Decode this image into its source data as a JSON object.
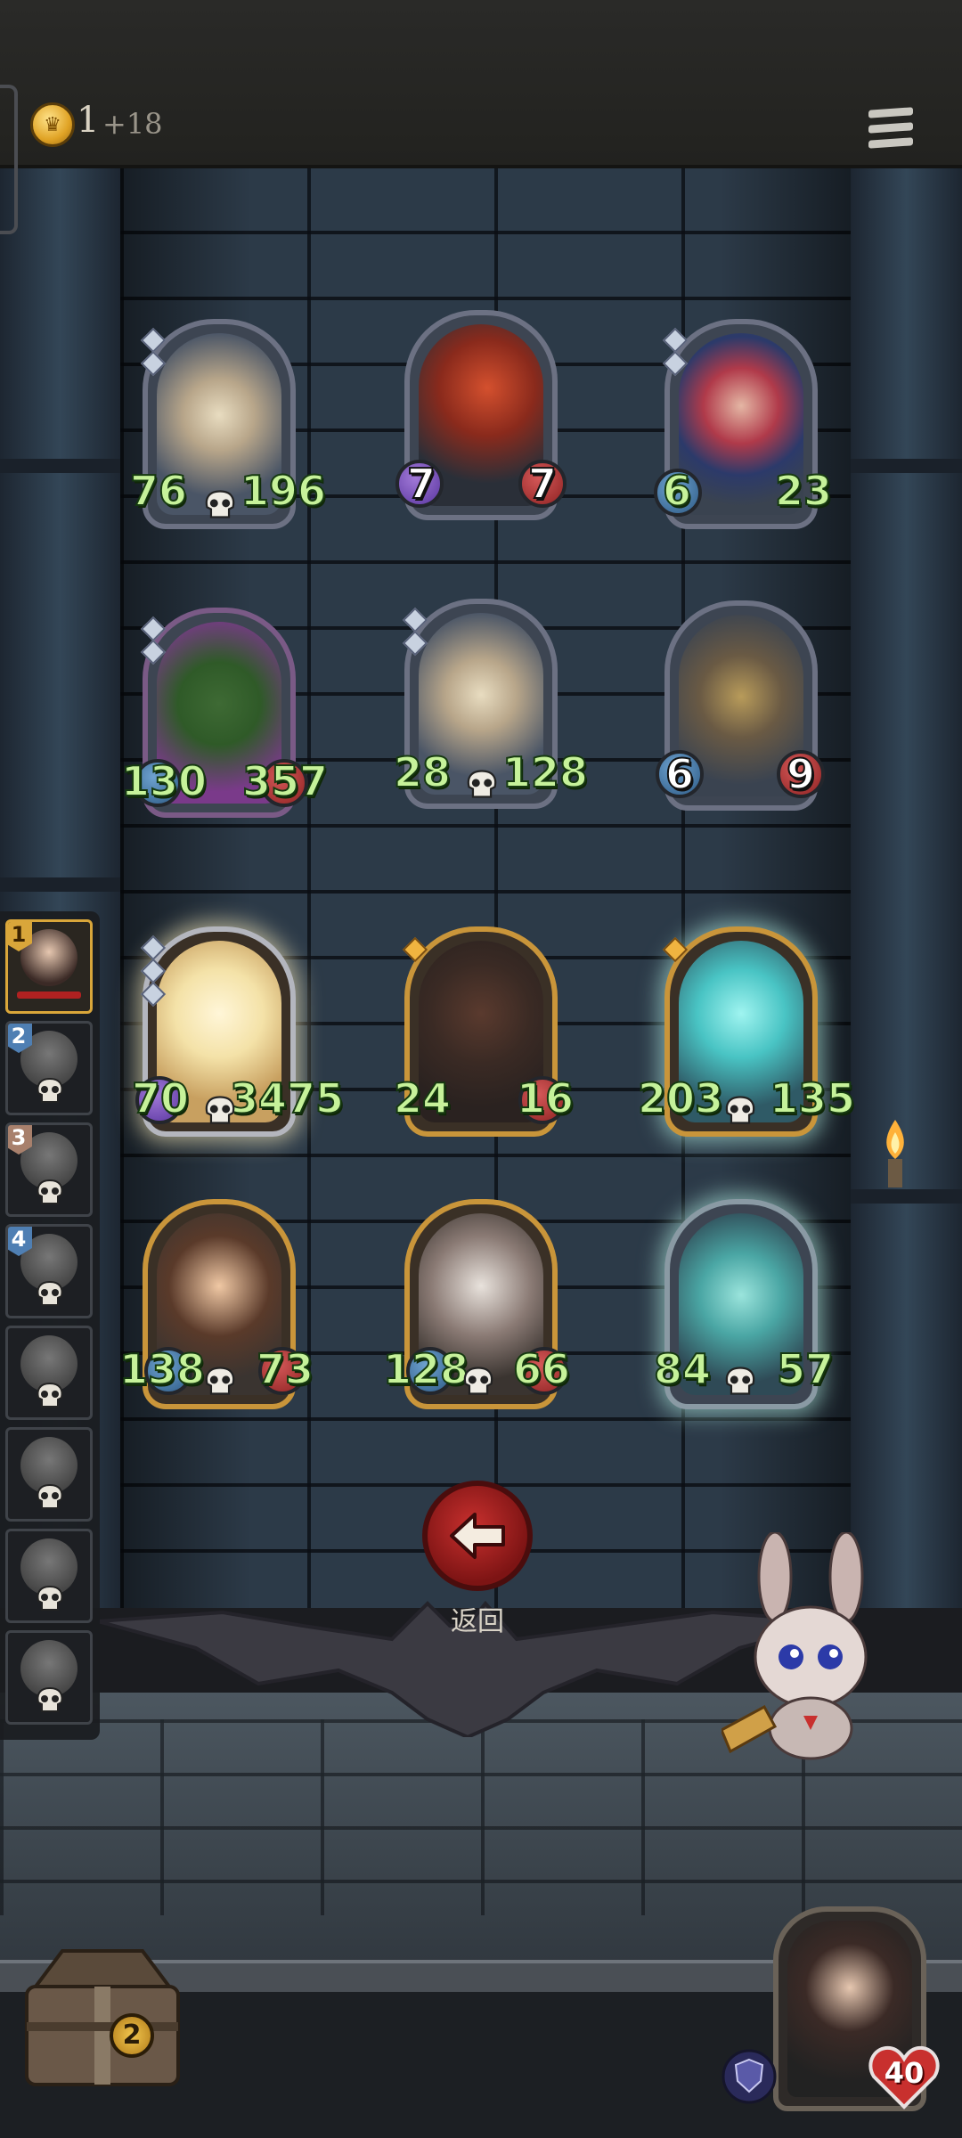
{
  "header": {
    "gold_count": "1",
    "gold_income": "+18",
    "coin_icon": "crown-coin-icon",
    "menu_icon": "hamburger-menu-icon"
  },
  "party": {
    "slots": [
      {
        "number": "1",
        "active": true,
        "badge_color": "#d9a63a"
      },
      {
        "number": "2",
        "active": false,
        "badge_color": "#4f7fb3"
      },
      {
        "number": "3",
        "active": false,
        "badge_color": "#a8806c"
      },
      {
        "number": "4",
        "active": false,
        "badge_color": "#4f7fb3"
      },
      {
        "number": "",
        "active": false
      },
      {
        "number": "",
        "active": false
      },
      {
        "number": "",
        "active": false
      },
      {
        "number": "",
        "active": false
      }
    ]
  },
  "enemies": [
    {
      "name": "bone-dragon",
      "attack": "76",
      "health": "196"
    },
    {
      "name": "hooded-assassin",
      "attack": "7",
      "health": "7"
    },
    {
      "name": "clown-jester",
      "attack": "6",
      "health": "23"
    },
    {
      "name": "swamp-treant",
      "attack": "130",
      "health": "357"
    },
    {
      "name": "bone-dragon",
      "attack": "28",
      "health": "128"
    },
    {
      "name": "scrap-golem",
      "attack": "6",
      "health": "9"
    }
  ],
  "allies": [
    {
      "name": "dwarf-warrior",
      "attack": "70",
      "health": "3475"
    },
    {
      "name": "hooded-witch",
      "attack": "24",
      "health": "16"
    },
    {
      "name": "ghost-knight",
      "attack": "203",
      "health": "135"
    },
    {
      "name": "girl-hero",
      "attack": "138",
      "health": "73"
    },
    {
      "name": "rabbit-mask",
      "attack": "128",
      "health": "66"
    },
    {
      "name": "ghost-warrior",
      "attack": "84",
      "health": "57"
    }
  ],
  "back_button": {
    "label": "返回"
  },
  "chest": {
    "count": "2"
  },
  "player": {
    "health": "40"
  },
  "colors": {
    "stat_green": "#c6f29a",
    "back_red": "#c8302e",
    "gold_frame": "#c9953a",
    "silver_frame": "#6c7183"
  }
}
